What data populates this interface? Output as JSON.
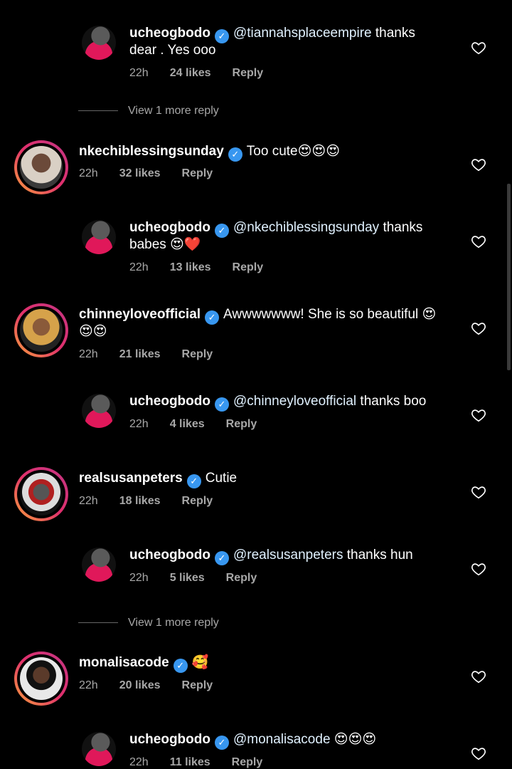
{
  "comments": [
    {
      "user": "ucheogbodo",
      "mention": "@tiannahsplaceempire",
      "text1": " thanks",
      "text2": "dear . Yes ooo",
      "time": "22h",
      "likes": "24 likes",
      "reply": "Reply"
    },
    {
      "view_more": "View 1 more reply"
    },
    {
      "user": "nkechiblessingsunday",
      "text1": "Too cute😍😍😍",
      "time": "22h",
      "likes": "32 likes",
      "reply": "Reply"
    },
    {
      "user": "ucheogbodo",
      "mention": "@nkechiblessingsunday",
      "text1": " thanks",
      "text2": "babes 😍❤️",
      "time": "22h",
      "likes": "13 likes",
      "reply": "Reply"
    },
    {
      "user": "chinneyloveofficial",
      "text1": "Awwwwwww! She is so beautiful 😍",
      "text2": "😍😍",
      "time": "22h",
      "likes": "21 likes",
      "reply": "Reply"
    },
    {
      "user": "ucheogbodo",
      "mention": "@chinneyloveofficial",
      "text1": " thanks boo",
      "time": "22h",
      "likes": "4 likes",
      "reply": "Reply"
    },
    {
      "user": "realsusanpeters",
      "text1": "Cutie",
      "time": "22h",
      "likes": "18 likes",
      "reply": "Reply"
    },
    {
      "user": "ucheogbodo",
      "mention": "@realsusanpeters",
      "text1": " thanks hun",
      "time": "22h",
      "likes": "5 likes",
      "reply": "Reply"
    },
    {
      "view_more": "View 1 more reply"
    },
    {
      "user": "monalisacode",
      "text1": "🥰",
      "time": "22h",
      "likes": "20 likes",
      "reply": "Reply"
    },
    {
      "user": "ucheogbodo",
      "mention": "@monalisacode",
      "text1": " 😍😍😍",
      "time": "22h",
      "likes": "11 likes",
      "reply": "Reply"
    }
  ],
  "verified_glyph": "✓",
  "colors": {
    "background": "#000000",
    "meta": "#a8a8a8",
    "verified": "#3897f0"
  }
}
